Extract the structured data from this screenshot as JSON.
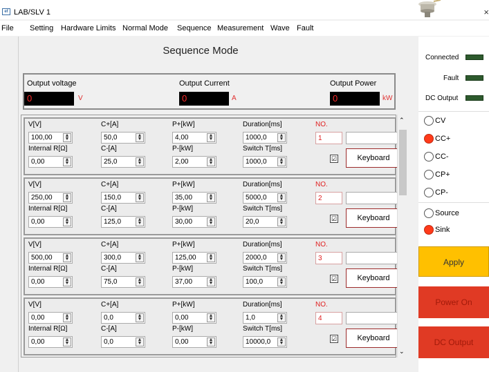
{
  "window": {
    "title": "LAB/SLV 1",
    "icon_text": "ef",
    "close": "×"
  },
  "menu": [
    "File",
    "Setting",
    "Hardware Limits",
    "Normal Mode",
    "Sequence",
    "Measurement",
    "Wave",
    "Fault"
  ],
  "page_title": "Sequence Mode",
  "readouts": {
    "voltage": {
      "label": "Output voltage",
      "value": "0",
      "unit": "V"
    },
    "current": {
      "label": "Output Current",
      "value": "0",
      "unit": "A"
    },
    "power": {
      "label": "Output Power",
      "value": "0",
      "unit": "kW"
    }
  },
  "labels": {
    "v": "V[V]",
    "cplus": "C+[A]",
    "pplus": "P+[kW]",
    "duration": "Duration[ms]",
    "no": "NO.",
    "internal_r": "Internal R[Ω]",
    "cminus": "C-[A]",
    "pminus": "P-[kW]",
    "switch_t": "Switch T[ms]",
    "keyboard": "Keyboard",
    "check": "☑"
  },
  "rows": [
    {
      "v": "100,00",
      "cplus": "50,0",
      "pplus": "4,00",
      "duration": "1000,0",
      "no": "1",
      "internal_r": "0,00",
      "cminus": "25,0",
      "pminus": "2,00",
      "switch_t": "1000,0"
    },
    {
      "v": "250,00",
      "cplus": "150,0",
      "pplus": "35,00",
      "duration": "5000,0",
      "no": "2",
      "internal_r": "0,00",
      "cminus": "125,0",
      "pminus": "30,00",
      "switch_t": "20,0"
    },
    {
      "v": "500,00",
      "cplus": "300,0",
      "pplus": "125,00",
      "duration": "2000,0",
      "no": "3",
      "internal_r": "0,00",
      "cminus": "75,0",
      "pminus": "37,00",
      "switch_t": "100,0"
    },
    {
      "v": "0,00",
      "cplus": "0,0",
      "pplus": "0,00",
      "duration": "1,0",
      "no": "4",
      "internal_r": "0,00",
      "cminus": "0,0",
      "pminus": "0,00",
      "switch_t": "10000,0"
    }
  ],
  "status": {
    "connected": "Connected",
    "fault": "Fault",
    "dc_output": "DC Output"
  },
  "modes": [
    {
      "label": "CV",
      "selected": false
    },
    {
      "label": "CC+",
      "selected": true
    },
    {
      "label": "CC-",
      "selected": false
    },
    {
      "label": "CP+",
      "selected": false
    },
    {
      "label": "CP-",
      "selected": false
    }
  ],
  "directions": [
    {
      "label": "Source",
      "selected": false
    },
    {
      "label": "Sink",
      "selected": true
    }
  ],
  "buttons": {
    "apply": "Apply",
    "power_on": "Power On",
    "dc_output": "DC Output"
  },
  "colors": {
    "apply": "#ffc000",
    "power": "#e03a24",
    "led": "#2d5a2d",
    "display": "#000000",
    "display_text": "#ff2a2a"
  }
}
